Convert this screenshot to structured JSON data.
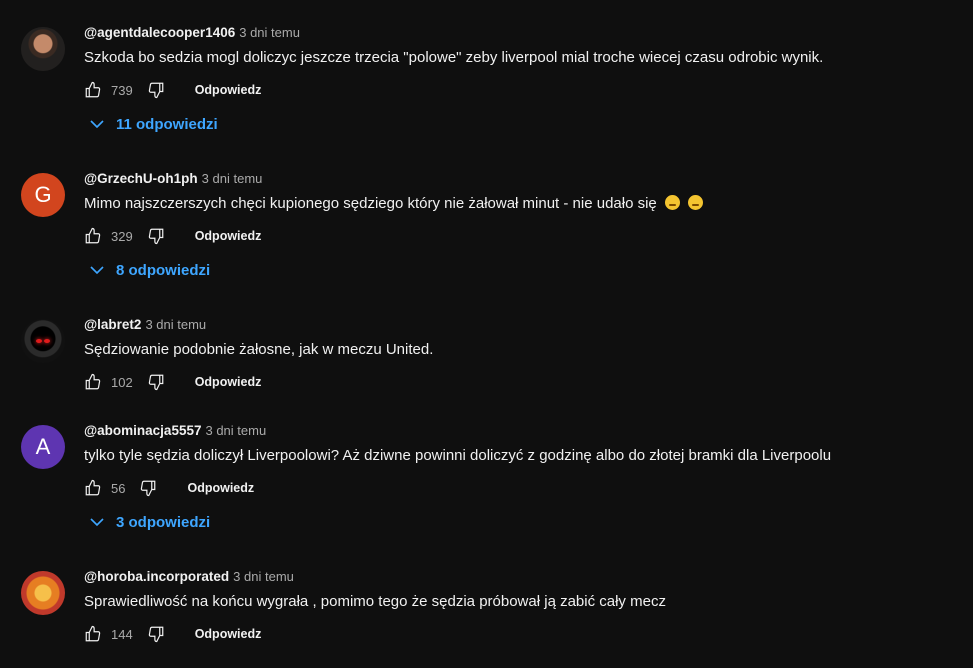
{
  "reply_label": "Odpowiedz",
  "colors": {
    "accent": "#3ea6ff",
    "background": "#0f0f0f",
    "text": "#f1f1f1",
    "muted": "#aaaaaa"
  },
  "comments": [
    {
      "author": "@agentdalecooper1406",
      "time": "3 dni temu",
      "text": "Szkoda bo sedzia mogl doliczyc jeszcze trzecia \"polowe\" zeby liverpool mial troche wiecej czasu odrobic wynik.",
      "likes": "739",
      "replies": "11 odpowiedzi",
      "avatar": "photo"
    },
    {
      "author": "@GrzechU-oh1ph",
      "time": "3 dni temu",
      "text": "Mimo najszczerszych chęci kupionego sędziego który nie żałował minut - nie udało się",
      "emoji": [
        "crying-face-emoji",
        "grinning-sweat-emoji"
      ],
      "likes": "329",
      "replies": "8 odpowiedzi",
      "avatar_letter": "G"
    },
    {
      "author": "@labret2",
      "time": "3 dni temu",
      "text": "Sędziowanie podobnie żałosne, jak w meczu United.",
      "likes": "102",
      "avatar": "photo"
    },
    {
      "author": "@abominacja5557",
      "time": "3 dni temu",
      "text": "tylko tyle sędzia doliczył Liverpoolowi? Aż dziwne powinni doliczyć z godzinę albo do złotej bramki dla Liverpoolu",
      "likes": "56",
      "replies": "3 odpowiedzi",
      "avatar_letter": "A"
    },
    {
      "author": "@horoba.incorporated",
      "time": "3 dni temu",
      "text": "Sprawiedliwość na końcu wygrała , pomimo tego że sędzia próbował ją zabić cały mecz",
      "likes": "144",
      "avatar": "photo"
    }
  ]
}
